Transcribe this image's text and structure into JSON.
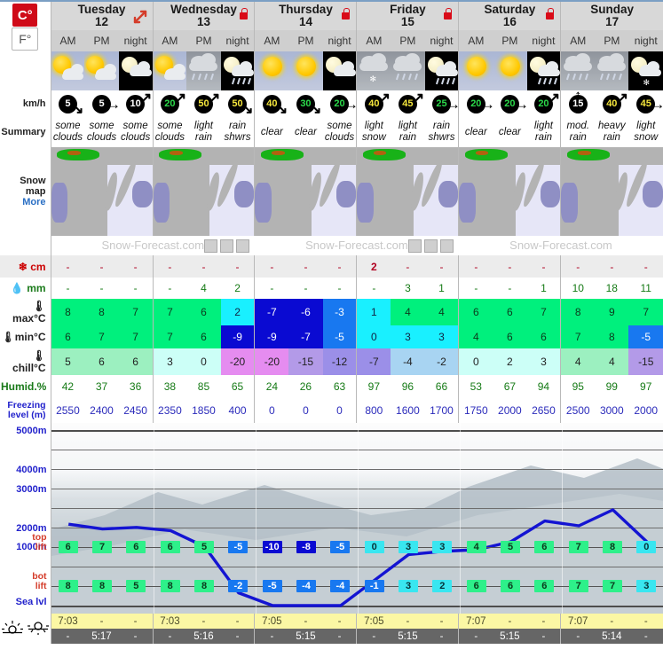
{
  "units": {
    "celsius_label": "C°",
    "fahrenheit_label": "F°",
    "active": "C°"
  },
  "labels": {
    "wind": "km/h",
    "summary": "Summary",
    "snow_map": "Snow map",
    "snow_map_more": "More",
    "snow_cm": "cm",
    "rain_mm": "mm",
    "max_c": "max°C",
    "min_c": "min°C",
    "chill_c": "chill°C",
    "humidity": "Humid.%",
    "freezing_level": "Freezing level (m)",
    "top_lift": "top lift",
    "bot_lift": "bot lift",
    "sea_level": "Sea lvl",
    "watermark": "Snow-Forecast.com"
  },
  "days": [
    {
      "name": "Tuesday",
      "date": "12",
      "locked": false,
      "expandable": true
    },
    {
      "name": "Wednesday",
      "date": "13",
      "locked": true,
      "expandable": false
    },
    {
      "name": "Thursday",
      "date": "14",
      "locked": true,
      "expandable": false
    },
    {
      "name": "Friday",
      "date": "15",
      "locked": true,
      "expandable": false
    },
    {
      "name": "Saturday",
      "date": "16",
      "locked": true,
      "expandable": false
    },
    {
      "name": "Sunday",
      "date": "17",
      "locked": false,
      "expandable": false
    }
  ],
  "periods": [
    "AM",
    "PM",
    "night",
    "AM",
    "PM",
    "night",
    "AM",
    "PM",
    "night",
    "AM",
    "PM",
    "night",
    "AM",
    "PM",
    "night",
    "AM",
    "PM",
    "night"
  ],
  "weather_icons": [
    "sun-cloud",
    "sun-cloud",
    "moon-cloud",
    "sun-cloud",
    "cloud-rain",
    "moon-rain",
    "sun",
    "sun",
    "moon-cloud",
    "cloud-snow",
    "cloud-rain",
    "moon-rain",
    "sun",
    "sun",
    "cloud-rain-night",
    "cloud-rain",
    "cloud-rain",
    "cloud-snow-night"
  ],
  "wind": {
    "speeds": [
      5,
      5,
      10,
      20,
      50,
      50,
      40,
      30,
      20,
      40,
      45,
      25,
      20,
      20,
      20,
      15,
      40,
      45
    ],
    "colors": [
      "#ffffff",
      "#ffffff",
      "#ffffff",
      "#2bd94a",
      "#f5e63c",
      "#f5e63c",
      "#f5e63c",
      "#2bd94a",
      "#2bd94a",
      "#f5e63c",
      "#f5e63c",
      "#2bd94a",
      "#2bd94a",
      "#2bd94a",
      "#2bd94a",
      "#ffffff",
      "#f5e63c",
      "#f5e63c"
    ],
    "directions": [
      "SE",
      "E",
      "NE",
      "NE",
      "NE",
      "SE",
      "SE",
      "SE",
      "E",
      "NE",
      "NE",
      "E",
      "E",
      "E",
      "NE",
      "N",
      "NE",
      "E"
    ]
  },
  "summary": [
    "some clouds",
    "some clouds",
    "some clouds",
    "some clouds",
    "light rain",
    "rain shwrs",
    "clear",
    "clear",
    "some clouds",
    "light snow",
    "light rain",
    "rain shwrs",
    "clear",
    "clear",
    "light rain",
    "mod. rain",
    "heavy rain",
    "light snow"
  ],
  "snow_cm": [
    "-",
    "-",
    "-",
    "-",
    "-",
    "-",
    "-",
    "-",
    "-",
    "2",
    "-",
    "-",
    "-",
    "-",
    "-",
    "-",
    "-",
    "-"
  ],
  "rain_mm": [
    "-",
    "-",
    "-",
    "-",
    "4",
    "2",
    "-",
    "-",
    "-",
    "-",
    "3",
    "1",
    "-",
    "-",
    "1",
    "10",
    "18",
    "11"
  ],
  "max_c": [
    8,
    8,
    7,
    7,
    6,
    2,
    -7,
    -6,
    -3,
    1,
    4,
    4,
    6,
    6,
    7,
    8,
    9,
    7
  ],
  "min_c": [
    6,
    7,
    7,
    7,
    6,
    -9,
    -9,
    -7,
    -5,
    0,
    3,
    3,
    4,
    6,
    6,
    7,
    8,
    -5
  ],
  "chill_c": [
    5,
    6,
    6,
    3,
    0,
    -20,
    -20,
    -15,
    -12,
    -7,
    -4,
    -2,
    0,
    2,
    3,
    4,
    4,
    -15
  ],
  "humidity": [
    42,
    37,
    36,
    38,
    85,
    65,
    24,
    26,
    63,
    97,
    96,
    66,
    53,
    67,
    94,
    95,
    99,
    97
  ],
  "freezing_level": [
    2550,
    2400,
    2450,
    2350,
    1850,
    400,
    0,
    0,
    0,
    800,
    1600,
    1700,
    1750,
    2000,
    2650,
    2500,
    3000,
    2000
  ],
  "altitudes": [
    "5000m",
    "4000m",
    "3000m",
    "2000m",
    "1000m"
  ],
  "top_lift": [
    6,
    7,
    6,
    6,
    5,
    -5,
    -10,
    -8,
    -5,
    0,
    3,
    3,
    4,
    5,
    6,
    7,
    8,
    0
  ],
  "bot_lift": [
    8,
    8,
    5,
    8,
    8,
    -2,
    -5,
    -4,
    -4,
    -1,
    3,
    2,
    6,
    6,
    6,
    7,
    7,
    3
  ],
  "sunrise": [
    "7:03",
    "-",
    "-",
    "7:03",
    "-",
    "-",
    "7:05",
    "-",
    "-",
    "7:05",
    "-",
    "-",
    "7:07",
    "-",
    "-",
    "7:07",
    "-",
    "-"
  ],
  "sunset": [
    "-",
    "5:17",
    "-",
    "-",
    "5:16",
    "-",
    "-",
    "5:15",
    "-",
    "-",
    "5:15",
    "-",
    "-",
    "5:15",
    "-",
    "-",
    "5:14",
    "-"
  ],
  "colors": {
    "accent_red": "#cf0a18",
    "green": "#00f07d",
    "cyan": "#19f0ff",
    "blue": "#0a0af0",
    "mid_blue": "#1878f0",
    "pink": "#ff9ef0",
    "purple": "#9b8fe8",
    "light_blue": "#a8d4f2",
    "pale_cyan": "#ccfff7",
    "pale_green": "#9cf0c0"
  },
  "chart_data": {
    "type": "line",
    "title": "Freezing level (m)",
    "xlabel": "",
    "ylabel": "Altitude (m)",
    "ylim": [
      0,
      5500
    ],
    "grid": true,
    "x": [
      "Tue AM",
      "Tue PM",
      "Tue night",
      "Wed AM",
      "Wed PM",
      "Wed night",
      "Thu AM",
      "Thu PM",
      "Thu night",
      "Fri AM",
      "Fri PM",
      "Fri night",
      "Sat AM",
      "Sat PM",
      "Sat night",
      "Sun AM",
      "Sun PM",
      "Sun night"
    ],
    "series": [
      {
        "name": "Freezing level (m)",
        "values": [
          2550,
          2400,
          2450,
          2350,
          1850,
          400,
          0,
          0,
          0,
          800,
          1600,
          1700,
          1750,
          2000,
          2650,
          2500,
          3000,
          2000
        ]
      }
    ],
    "ytick_labels": [
      "Sea lvl",
      "1000m",
      "2000m",
      "3000m",
      "4000m",
      "5000m"
    ],
    "ytick_values": [
      0,
      1000,
      2000,
      3000,
      4000,
      5000
    ]
  }
}
